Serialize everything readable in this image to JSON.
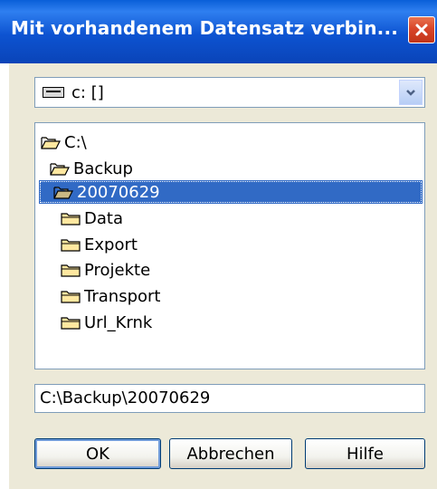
{
  "window": {
    "title": "Mit vorhandenem Datensatz verbin..."
  },
  "drive": {
    "selected": "c: []"
  },
  "folders": [
    {
      "label": "C:\\",
      "open": true
    },
    {
      "label": "Backup",
      "open": true
    },
    {
      "label": "20070629",
      "open": true,
      "selected": true
    },
    {
      "label": "Data",
      "open": false
    },
    {
      "label": "Export",
      "open": false
    },
    {
      "label": "Projekte",
      "open": false
    },
    {
      "label": "Transport",
      "open": false
    },
    {
      "label": "Url_Krnk",
      "open": false
    }
  ],
  "path": {
    "value": "C:\\Backup\\20070629"
  },
  "buttons": {
    "ok": "OK",
    "cancel": "Abbrechen",
    "help": "Hilfe"
  },
  "colors": {
    "title_bar": "#0a5fd8",
    "selection": "#316ac5",
    "close_button": "#d8452a",
    "dialog_face": "#ece9d8"
  }
}
